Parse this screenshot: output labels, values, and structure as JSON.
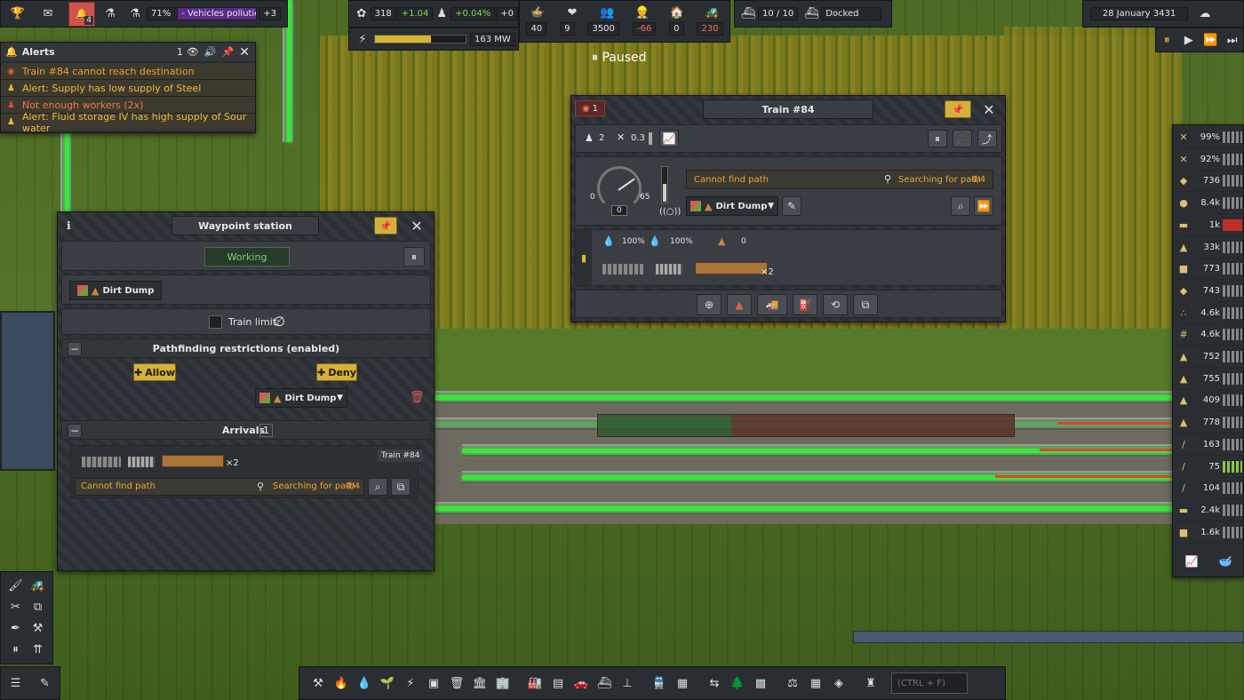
{
  "top_bar": {
    "research_percent": "71%",
    "research_label": "- Vehicles pollutio...",
    "research_more": "+3",
    "notification_count": "4",
    "unity": "318",
    "unity_delta": "+1.04",
    "pop_growth": "+0.04%",
    "pop_extra": "+0",
    "power_value": "163 MW",
    "power_fill": 0.62,
    "food": "40",
    "health": "9",
    "population": "3500",
    "workers": "-66",
    "housing": "0",
    "vehicles": "230",
    "ships": "10 / 10",
    "ship_status": "Docked",
    "date": "28 January 3431",
    "paused_label": "Paused"
  },
  "alerts": {
    "title": "Alerts",
    "count": "1",
    "items": [
      {
        "text": "Train #84 cannot reach destination",
        "color": "#f0a030"
      },
      {
        "text": "Alert: Supply has low supply of Steel",
        "color": "#f0b840"
      },
      {
        "text": "Not enough workers (2x)",
        "color": "#f07a40"
      },
      {
        "text": "Alert: Fluid storage IV has high supply of Sour water",
        "color": "#f0b840"
      }
    ]
  },
  "waypoint": {
    "title": "Waypoint station",
    "status": "Working",
    "destination": "Dirt Dump",
    "train_limit_label": "Train limit:",
    "train_limit_value": "∅",
    "restrictions_title": "Pathfinding restrictions (enabled)",
    "allow_label": "Allow",
    "deny_label": "Deny",
    "restriction_cargo": "Dirt Dump",
    "arrivals_title": "Arrivals",
    "arrivals_count": "1",
    "arrival_train": "Train #84",
    "arrival_multiplier": "×2",
    "arrival_status": "Cannot find path",
    "arrival_search": "Searching for path",
    "arrival_search_count": "4/4"
  },
  "train": {
    "title": "Train #84",
    "alert_count": "1",
    "workers": "2",
    "maintenance": "0.3",
    "speed_max": "65",
    "speed_min": "0",
    "speed_current": "0",
    "status": "Cannot find path",
    "search": "Searching for path",
    "search_count": "4/4",
    "destination": "Dirt Dump",
    "loco1_fuel": "100%",
    "loco2_fuel": "100%",
    "wagon_cargo": "0",
    "wagon_multiplier": "×2"
  },
  "resources": [
    {
      "icon": "✕",
      "value": "99%"
    },
    {
      "icon": "✕",
      "value": "92%"
    },
    {
      "icon": "◆",
      "value": "736"
    },
    {
      "icon": "●",
      "value": "8.4k"
    },
    {
      "icon": "▬",
      "value": "1k"
    },
    {
      "icon": "▲",
      "value": "33k"
    },
    {
      "icon": "■",
      "value": "773"
    },
    {
      "icon": "◆",
      "value": "743"
    },
    {
      "icon": "∴",
      "value": "4.6k"
    },
    {
      "icon": "#",
      "value": "4.6k"
    },
    {
      "icon": "▲",
      "value": "752"
    },
    {
      "icon": "▲",
      "value": "755"
    },
    {
      "icon": "▲",
      "value": "409"
    },
    {
      "icon": "▲",
      "value": "778"
    },
    {
      "icon": "/",
      "value": "163"
    },
    {
      "icon": "/",
      "value": "75"
    },
    {
      "icon": "/",
      "value": "104"
    },
    {
      "icon": "▬",
      "value": "2.4k"
    },
    {
      "icon": "■",
      "value": "1.6k"
    }
  ],
  "search_bar": {
    "placeholder": "(CTRL + F)"
  },
  "colors": {
    "green_track": "#38e838",
    "accent_yellow": "#d4b13a",
    "alert_orange": "#f0a030"
  }
}
